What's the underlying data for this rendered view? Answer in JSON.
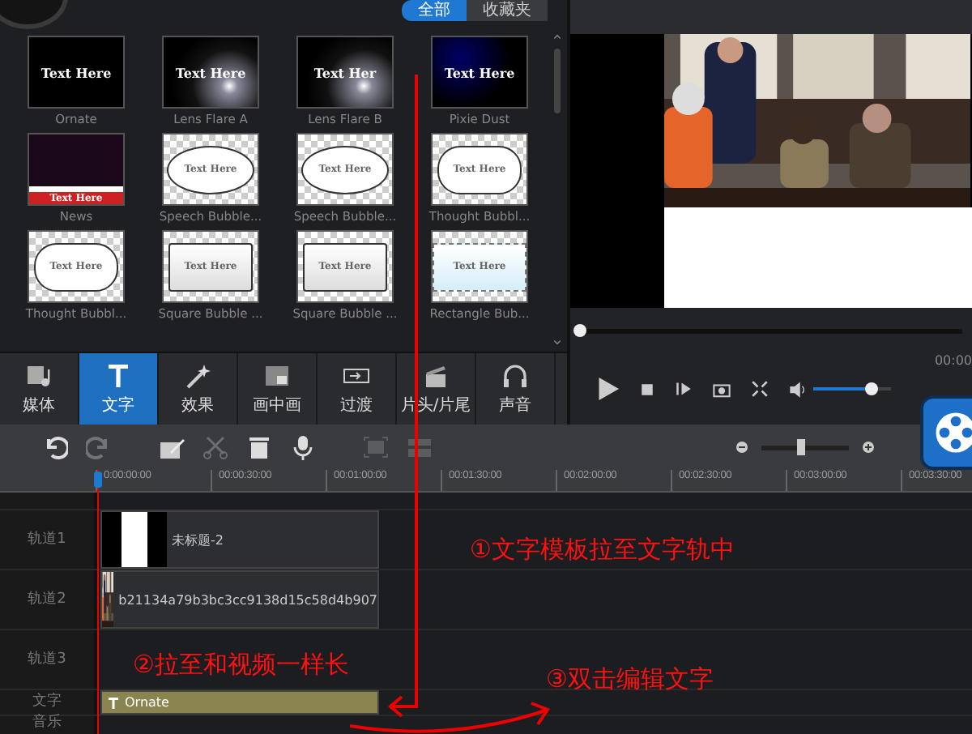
{
  "library": {
    "tabs": [
      {
        "label": "全部",
        "selected": true
      },
      {
        "label": "收藏夹",
        "selected": false
      }
    ],
    "templates": [
      {
        "label": "Ornate",
        "kind": "ornate",
        "preview_text": "Text Here"
      },
      {
        "label": "Lens Flare A",
        "kind": "flare",
        "preview_text": "Text Here"
      },
      {
        "label": "Lens Flare B",
        "kind": "flare",
        "preview_text": "Text Her"
      },
      {
        "label": "Pixie Dust",
        "kind": "dust",
        "preview_text": "Text Here"
      },
      {
        "label": "News",
        "kind": "news",
        "preview_text": "Text Here"
      },
      {
        "label": "Speech Bubble...",
        "kind": "speech",
        "preview_text": "Text Here"
      },
      {
        "label": "Speech Bubble...",
        "kind": "speech",
        "preview_text": "Text Here"
      },
      {
        "label": "Thought Bubbl...",
        "kind": "thought",
        "preview_text": "Text Here"
      },
      {
        "label": "Thought Bubbl...",
        "kind": "thought",
        "preview_text": "Text Here"
      },
      {
        "label": "Square Bubble ...",
        "kind": "square",
        "preview_text": "Text Here"
      },
      {
        "label": "Square Bubble ...",
        "kind": "square",
        "preview_text": "Text Here"
      },
      {
        "label": "Rectangle Bub...",
        "kind": "rect",
        "preview_text": "Text Here"
      }
    ]
  },
  "categories": [
    {
      "label": "媒体",
      "kind": "media",
      "selected": false
    },
    {
      "label": "文字",
      "kind": "text",
      "selected": true
    },
    {
      "label": "效果",
      "kind": "effects",
      "selected": false
    },
    {
      "label": "画中画",
      "kind": "pip",
      "selected": false
    },
    {
      "label": "过渡",
      "kind": "transition",
      "selected": false
    },
    {
      "label": "片头/片尾",
      "kind": "clapper",
      "selected": false
    },
    {
      "label": "声音",
      "kind": "audio",
      "selected": false
    }
  ],
  "preview": {
    "time": "00:00",
    "progress": {
      "level": 0
    },
    "volume": {
      "level": 0.76
    }
  },
  "toolbar": [
    {
      "kind": "undo",
      "disabled": false
    },
    {
      "kind": "redo",
      "disabled": true
    },
    {
      "kind": "edit",
      "disabled": false
    },
    {
      "kind": "cut",
      "disabled": true
    },
    {
      "kind": "delete",
      "disabled": false
    },
    {
      "kind": "mic",
      "disabled": false
    },
    {
      "kind": "crop",
      "disabled": true
    },
    {
      "kind": "split",
      "disabled": true
    }
  ],
  "zoom": {
    "level": 0.45
  },
  "ruler": [
    "0:00:00:00",
    "00:00:30:00",
    "00:01:00:00",
    "00:01:30:00",
    "00:02:00:00",
    "00:02:30:00",
    "00:03:00:00",
    "00:03:30:00"
  ],
  "tracks": [
    {
      "label": "轨道1",
      "clip": {
        "label": "未标题-2"
      }
    },
    {
      "label": "轨道2",
      "clip": {
        "kind": "video",
        "label": "b21134a79b3bc3cc9138d15c58d4b907"
      }
    },
    {
      "label": "轨道3"
    },
    {
      "label": "文字",
      "clip": {
        "kind": "text",
        "label": "Ornate"
      }
    },
    {
      "label": "音乐"
    }
  ],
  "annotations": [
    "①文字模板拉至文字轨中",
    "②拉至和视频一样长",
    "③双击编辑文字"
  ]
}
